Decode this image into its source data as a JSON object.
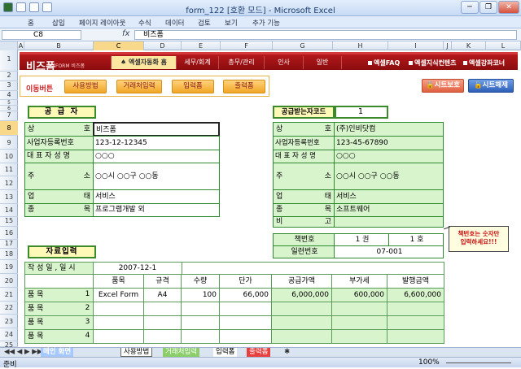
{
  "window": {
    "title": "form_122  [호환 모드] - Microsoft Excel",
    "buttons": [
      "─",
      "❐",
      "✕"
    ]
  },
  "ribbon": {
    "tabs": [
      "홈",
      "삽입",
      "페이지 레이아웃",
      "수식",
      "데이터",
      "검토",
      "보기",
      "추가 기능"
    ]
  },
  "formula": {
    "namebox": "C8",
    "fx": "fx",
    "value": "비즈폼"
  },
  "columns": [
    "A",
    "B",
    "C",
    "D",
    "E",
    "F",
    "G",
    "H",
    "I",
    "J",
    "K",
    "L"
  ],
  "rows": [
    "1",
    "2",
    "3",
    "4",
    "5",
    "6",
    "7",
    "8",
    "9",
    "10",
    "11",
    "12",
    "13",
    "14",
    "15",
    "16",
    "17",
    "18",
    "19",
    "20",
    "21",
    "22",
    "23",
    "24",
    "25"
  ],
  "banner": {
    "logo": "비즈폼",
    "logo_sub": "BIZFORM 비즈폼",
    "nav": [
      "엑셀자동화 홈",
      "세무/회계",
      "총무/관리",
      "인사",
      "일반"
    ],
    "links": [
      "엑셀FAQ",
      "엑셀지식컨텐츠",
      "엑셀강좌코너"
    ]
  },
  "buttons": {
    "move_label": "이동버튼",
    "items": [
      "사용방법",
      "거래처입력",
      "입력폼",
      "출력폼"
    ],
    "protect": "시트보호",
    "unprotect": "시트해제"
  },
  "supplier": {
    "header": "공 급 자",
    "labels": [
      {
        "left": "상",
        "right": "호"
      },
      {
        "left": "사업자등록번호",
        "right": ""
      },
      {
        "left": "대 표 자 성 명",
        "right": ""
      },
      {
        "left": "주",
        "right": "소"
      },
      {
        "left": "업",
        "right": "태"
      },
      {
        "left": "종",
        "right": "목"
      }
    ],
    "values": [
      "비즈폼",
      "123-12-12345",
      "○○○",
      "○○시 ○○구 ○○동",
      "서비스",
      "프로그램개발 외"
    ]
  },
  "receiver": {
    "header": "공급받는자코드",
    "code": "1",
    "labels": [
      {
        "left": "상",
        "right": "호"
      },
      {
        "left": "사업자등록번호",
        "right": ""
      },
      {
        "left": "대 표 자 성 명",
        "right": ""
      },
      {
        "left": "주",
        "right": "소"
      },
      {
        "left": "업",
        "right": "태"
      },
      {
        "left": "종",
        "right": "목"
      },
      {
        "left": "비",
        "right": "고"
      }
    ],
    "values": [
      "(주)인비닷컴",
      "123-45-67890",
      "○○○",
      "○○시 ○○구 ○○동",
      "서비스",
      "소프트웨어",
      ""
    ]
  },
  "book": {
    "label1": "책번호",
    "vol": "1 권",
    "no": "1 호",
    "label2": "일련번호",
    "serial": "07-001"
  },
  "comment": "책번호는 숫자만\n입력하세요!!!",
  "input": {
    "header": "자료입력",
    "date_label": "작 성 일 , 일 시",
    "date": "2007-12-1",
    "columns": [
      "품목",
      "규격",
      "수량",
      "단가",
      "공급가액",
      "부가세",
      "발행금액"
    ],
    "row_label": "품      목",
    "rows": [
      {
        "n": "1",
        "item": "Excel Form",
        "spec": "A4",
        "qty": "100",
        "price": "66,000",
        "supply": "6,000,000",
        "vat": "600,000",
        "total": "6,600,000"
      },
      {
        "n": "2",
        "item": "",
        "spec": "",
        "qty": "",
        "price": "",
        "supply": "",
        "vat": "",
        "total": ""
      },
      {
        "n": "3",
        "item": "",
        "spec": "",
        "qty": "",
        "price": "",
        "supply": "",
        "vat": "",
        "total": ""
      },
      {
        "n": "4",
        "item": "",
        "spec": "",
        "qty": "",
        "price": "",
        "supply": "",
        "vat": "",
        "total": ""
      }
    ]
  },
  "sheet_tabs": [
    "메인 화면",
    "사용방법",
    "거래처입력",
    "입력폼",
    "출력폼"
  ],
  "status": {
    "ready": "준비",
    "zoom": "100%"
  }
}
